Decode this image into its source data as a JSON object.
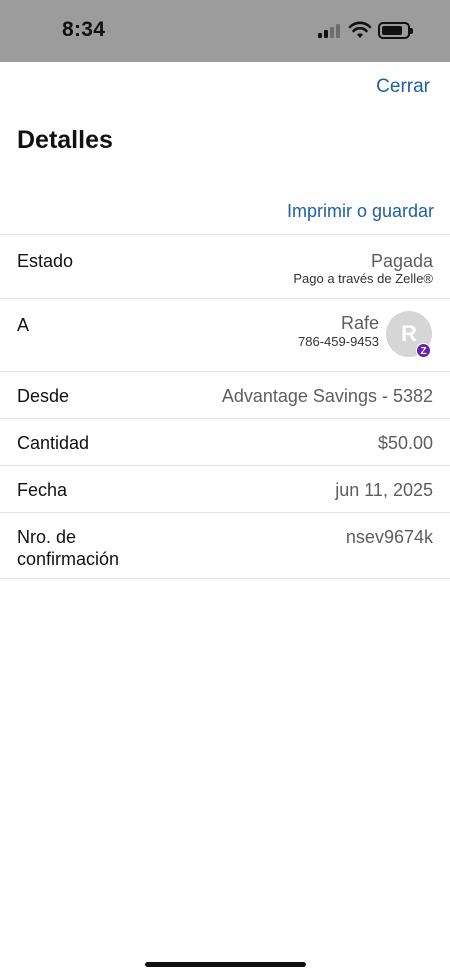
{
  "status_bar": {
    "time": "8:34"
  },
  "header": {
    "close_label": "Cerrar",
    "title": "Detalles",
    "print_label": "Imprimir o guardar"
  },
  "details": {
    "estado": {
      "label": "Estado",
      "value": "Pagada",
      "sub": "Pago a través de Zelle®"
    },
    "a": {
      "label": "A",
      "name": "Rafe",
      "phone": "786-459-9453",
      "avatar_initial": "R",
      "badge": "Z"
    },
    "desde": {
      "label": "Desde",
      "value": "Advantage Savings - 5382"
    },
    "cantidad": {
      "label": "Cantidad",
      "value": "$50.00"
    },
    "fecha": {
      "label": "Fecha",
      "value": "jun 11, 2025"
    },
    "confirmacion": {
      "label": "Nro. de confirmación",
      "value": "nsev9674k"
    }
  },
  "colors": {
    "accent": "#1f5fa3",
    "zelle": "#6b1fb1",
    "status_bar": "#9c9c9c"
  }
}
